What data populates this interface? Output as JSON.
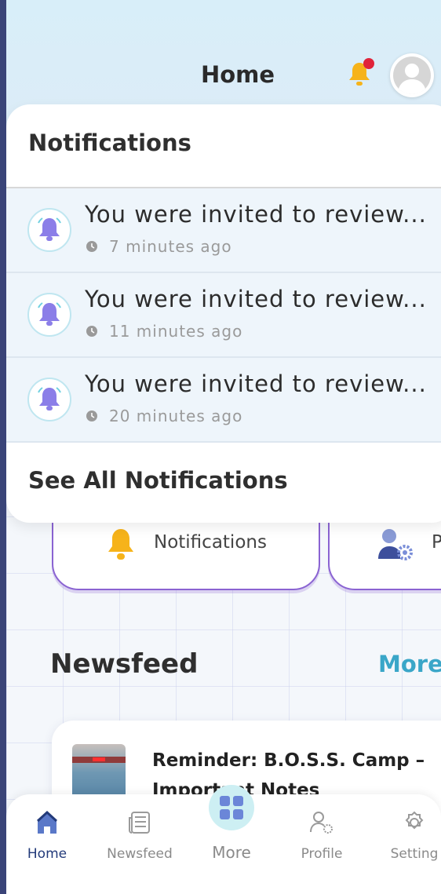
{
  "header": {
    "title": "Home",
    "has_unread_dot": true
  },
  "notifications_panel": {
    "heading": "Notifications",
    "items": [
      {
        "text": "You were invited to review...",
        "time": "7 minutes ago"
      },
      {
        "text": "You were invited to review...",
        "time": "11 minutes ago"
      },
      {
        "text": "You were invited to review...",
        "time": "20 minutes ago"
      }
    ],
    "see_all": "See All Notifications"
  },
  "quick_actions": {
    "notifications_label": "Notifications",
    "profile_label": "P"
  },
  "newsfeed": {
    "heading": "Newsfeed",
    "more_label": "More",
    "cards": [
      {
        "title": "Reminder: B.O.S.S. Camp – Important Notes"
      }
    ]
  },
  "bottom_nav": {
    "items": [
      {
        "label": "Home",
        "icon": "home-icon",
        "active": true
      },
      {
        "label": "Newsfeed",
        "icon": "newspaper-icon",
        "active": false
      },
      {
        "label": "More",
        "icon": "grid-icon",
        "active": false
      },
      {
        "label": "Profile",
        "icon": "user-settings-icon",
        "active": false
      },
      {
        "label": "Setting",
        "icon": "gear-icon",
        "active": false
      }
    ]
  },
  "colors": {
    "accent": "#3aa6c8",
    "card_border": "#8a63d2",
    "bell": "#f6b31a",
    "unread_dot": "#e0243a",
    "nav_active": "#223a7a"
  }
}
